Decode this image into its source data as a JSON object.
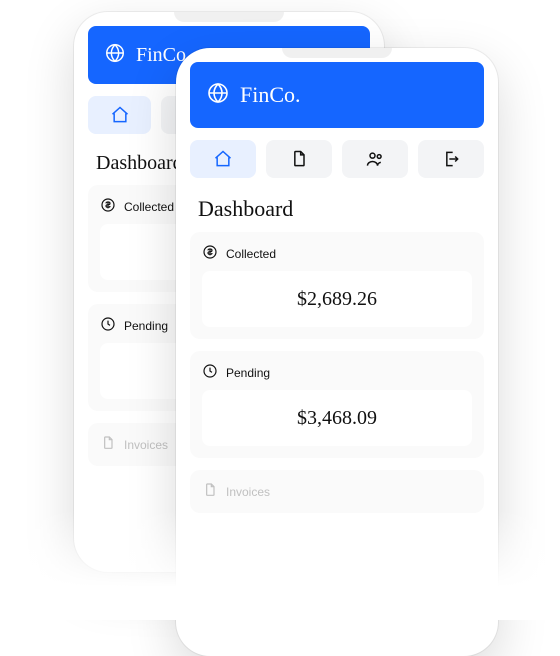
{
  "brand": {
    "name": "FinCo."
  },
  "nav": {
    "items": [
      {
        "name": "home",
        "active": true
      },
      {
        "name": "invoices",
        "active": false
      },
      {
        "name": "customers",
        "active": false
      },
      {
        "name": "signout",
        "active": false
      }
    ]
  },
  "page": {
    "title": "Dashboard"
  },
  "cards": {
    "collected": {
      "label": "Collected",
      "value": "$2,689.26"
    },
    "pending": {
      "label": "Pending",
      "value": "$3,468.09"
    },
    "invoices": {
      "label": "Invoices"
    }
  }
}
